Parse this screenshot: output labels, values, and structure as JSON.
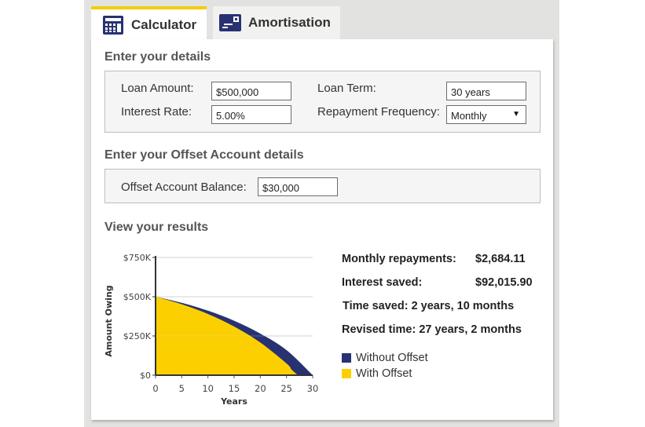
{
  "tabs": [
    {
      "label": "Calculator",
      "icon": "calculator-icon",
      "active": true
    },
    {
      "label": "Amortisation",
      "icon": "amortisation-icon",
      "active": false
    }
  ],
  "details": {
    "heading": "Enter your details",
    "loan_amount_label": "Loan Amount:",
    "loan_amount_value": "$500,000",
    "interest_rate_label": "Interest Rate:",
    "interest_rate_value": "5.00%",
    "loan_term_label": "Loan Term:",
    "loan_term_value": "30 years",
    "frequency_label": "Repayment Frequency:",
    "frequency_value": "Monthly",
    "frequency_arrow": "▼"
  },
  "offset": {
    "heading": "Enter your Offset Account details",
    "balance_label": "Offset Account Balance:",
    "balance_value": "$30,000"
  },
  "results": {
    "heading": "View your results",
    "monthly_label": "Monthly repayments:",
    "monthly_value": "$2,684.11",
    "interest_label": "Interest saved:",
    "interest_value": "$92,015.90",
    "time_saved": "Time saved: 2 years, 10 months",
    "revised_time": "Revised time: 27 years, 2 months"
  },
  "colors": {
    "accent": "#f2cd00",
    "navy": "#283272",
    "yellow": "#fcd000"
  },
  "chart_data": {
    "type": "area",
    "xlabel": "Years",
    "ylabel": "Amount Owing",
    "xlim": [
      0,
      30
    ],
    "ylim": [
      0,
      750000
    ],
    "x_ticks": [
      "0",
      "5",
      "10",
      "15",
      "20",
      "25",
      "30"
    ],
    "y_ticks": [
      "$0",
      "$250K",
      "$500K",
      "$750K"
    ],
    "y_tick_values": [
      0,
      250000,
      500000,
      750000
    ],
    "grid": true,
    "legend_position": "right",
    "series": [
      {
        "name": "Without Offset",
        "color": "#283272",
        "x": [
          0,
          5,
          10,
          15,
          20,
          25,
          30
        ],
        "values": [
          500000,
          461000,
          411000,
          347000,
          265000,
          160000,
          0
        ]
      },
      {
        "name": "With Offset",
        "color": "#fcd000",
        "x": [
          0,
          5,
          10,
          15,
          20,
          25,
          26,
          27.17
        ],
        "values": [
          500000,
          452000,
          390000,
          310000,
          208000,
          75000,
          35000,
          0
        ]
      }
    ]
  }
}
